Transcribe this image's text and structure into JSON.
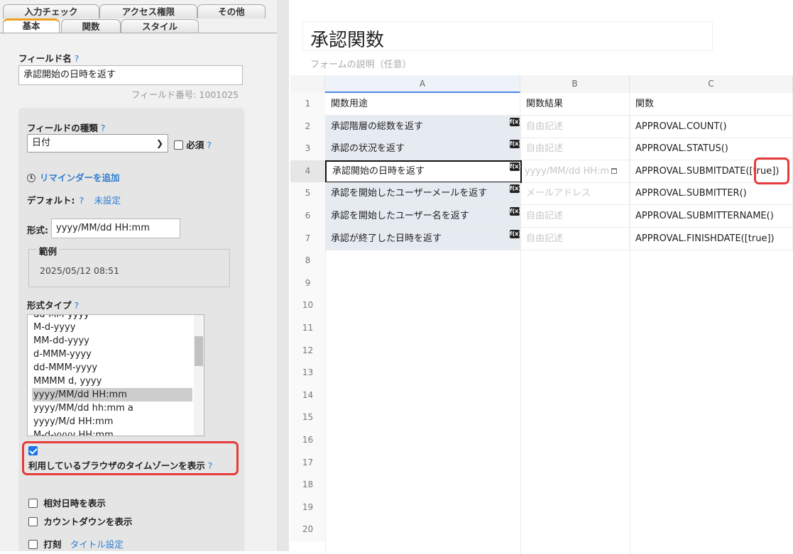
{
  "tabs_top": [
    "入力チェック",
    "アクセス権限",
    "その他"
  ],
  "tabs_bottom": [
    "基本",
    "関数",
    "スタイル"
  ],
  "field_name": {
    "label": "フィールド名",
    "help": "?",
    "value": "承認開始の日時を返す",
    "number_note": "フィールド番号: 1001025"
  },
  "field_type": {
    "label": "フィールドの種類",
    "help": "?",
    "selected": "日付",
    "required_label": "必須",
    "required_help": "?"
  },
  "reminder": {
    "link": "リマインダーを追加"
  },
  "default": {
    "label": "デフォルト:",
    "help": "?",
    "value": "未設定"
  },
  "format": {
    "label": "形式:",
    "value": "yyyy/MM/dd HH:mm"
  },
  "example": {
    "legend": "範例",
    "value": "2025/05/12 08:51"
  },
  "format_type": {
    "label": "形式タイプ",
    "help": "?",
    "items": [
      "dd-MM-yyyy",
      "M-d-yyyy",
      "MM-dd-yyyy",
      "d-MMM-yyyy",
      "dd-MMM-yyyy",
      "MMMM d, yyyy",
      "yyyy/MM/dd HH:mm",
      "yyyy/MM/dd hh:mm a",
      "yyyy/M/d HH:mm",
      "M-d-yyyy HH:mm"
    ],
    "selected": "yyyy/MM/dd HH:mm"
  },
  "timezone": {
    "label": "利用しているブラウザのタイムゾーンを表示",
    "help": "?",
    "checked": true
  },
  "options": {
    "relative": "相対日時を表示",
    "countdown": "カウントダウンを表示",
    "stamp": "打刻",
    "title_setting": "タイトル設定"
  },
  "sheet": {
    "title": "承認関数",
    "description": "フォームの説明（任意）",
    "columns": [
      "A",
      "B",
      "C"
    ],
    "row_numbers": [
      "1",
      "2",
      "3",
      "4",
      "5",
      "6",
      "7",
      "8",
      "9",
      "10",
      "11",
      "12",
      "13",
      "14",
      "15",
      "16",
      "17",
      "18",
      "19",
      "20"
    ],
    "header": [
      "関数用途",
      "関数結果",
      "関数"
    ],
    "rows": [
      {
        "a": "承認階層の総数を返す",
        "b": "自由記述",
        "c": "APPROVAL.COUNT()"
      },
      {
        "a": "承認の状況を返す",
        "b": "自由記述",
        "c": "APPROVAL.STATUS()"
      },
      {
        "a": "承認開始の日時を返す",
        "b": "yyyy/MM/dd HH:m",
        "c": "APPROVAL.SUBMITDATE([true])"
      },
      {
        "a": "承認を開始したユーザーメールを返す",
        "b": "メールアドレス",
        "c": "APPROVAL.SUBMITTER()"
      },
      {
        "a": "承認を開始したユーザー名を返す",
        "b": "自由記述",
        "c": "APPROVAL.SUBMITTERNAME()"
      },
      {
        "a": "承認が終了した日時を返す",
        "b": "自由記述",
        "c": "APPROVAL.FINISHDATE([true])"
      }
    ],
    "fx_label": "f(x)"
  }
}
